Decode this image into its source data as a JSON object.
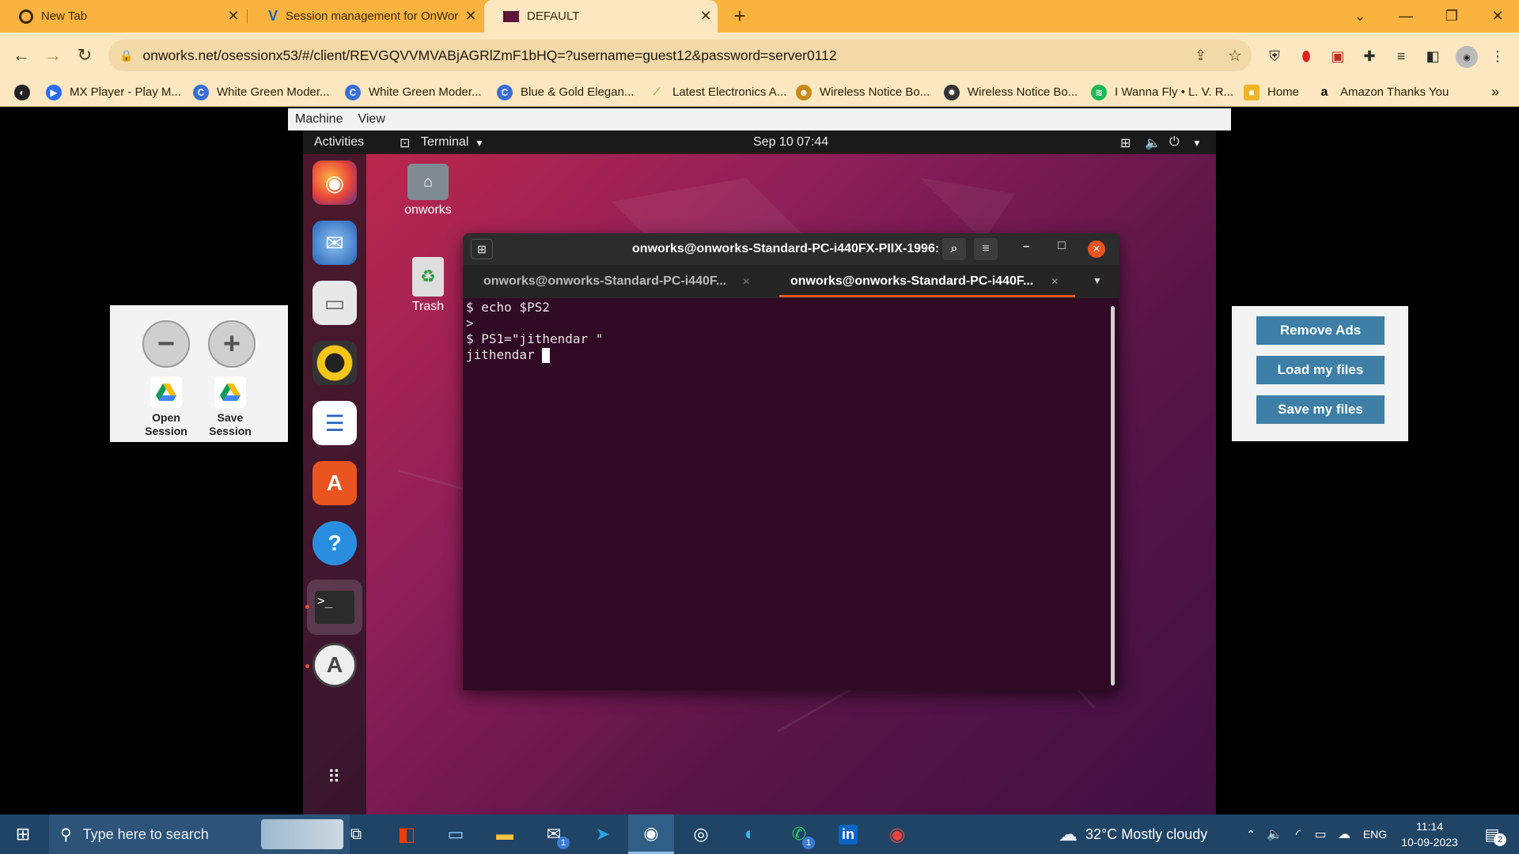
{
  "browser": {
    "tabs": [
      {
        "title": "New Tab",
        "active": false
      },
      {
        "title": "Session management for OnWorl",
        "active": false
      },
      {
        "title": "DEFAULT",
        "active": true
      }
    ],
    "new_tab_label": "+",
    "url": "onworks.net/osessionx53/#/client/REVGQVVMVABjAGRlZmF1bHQ=?username=guest12&password=server0112",
    "bookmarks": [
      {
        "label": "MX Player - Play M...",
        "color": "#2a6df4"
      },
      {
        "label": "White Green Moder...",
        "color": "#2a6df4"
      },
      {
        "label": "White Green Moder...",
        "color": "#2a6df4"
      },
      {
        "label": "Blue & Gold Elegan...",
        "color": "#2a6df4"
      },
      {
        "label": "Latest Electronics A...",
        "color": "#7ab648"
      },
      {
        "label": "Wireless Notice Bo...",
        "color": "#c98a1b"
      },
      {
        "label": "Wireless Notice Bo...",
        "color": "#333333"
      },
      {
        "label": "I Wanna Fly • L. V. R...",
        "color": "#1db954"
      },
      {
        "label": "Home",
        "color": "#f0b429"
      },
      {
        "label": "Amazon Thanks You",
        "color": "#111111"
      }
    ]
  },
  "machine_menu": {
    "machine": "Machine",
    "view": "View"
  },
  "vm": {
    "activities": "Activities",
    "app_menu": "Terminal",
    "clock": "Sep 10  07:44",
    "desktop_icons": {
      "home": "onworks",
      "trash": "Trash"
    }
  },
  "terminal": {
    "title": "onworks@onworks-Standard-PC-i440FX-PIIX-1996: ~",
    "tabs": [
      {
        "label": "onworks@onworks-Standard-PC-i440F...",
        "active": false
      },
      {
        "label": "onworks@onworks-Standard-PC-i440F...",
        "active": true
      }
    ],
    "lines": [
      "$ echo $PS2",
      ">",
      "$ PS1=\"jithendar \"",
      "jithendar "
    ]
  },
  "session_panel": {
    "open_label": "Open\nSession",
    "save_label": "Save\nSession"
  },
  "ads_panel": {
    "remove_ads": "Remove Ads",
    "load_files": "Load my files",
    "save_files": "Save my files"
  },
  "taskbar": {
    "search_placeholder": "Type here to search",
    "weather": "32°C  Mostly cloudy",
    "lang": "ENG",
    "time": "11:14",
    "date": "10-09-2023",
    "notif_count": "2",
    "mail_badge": "1",
    "whatsapp_badge": "1"
  }
}
